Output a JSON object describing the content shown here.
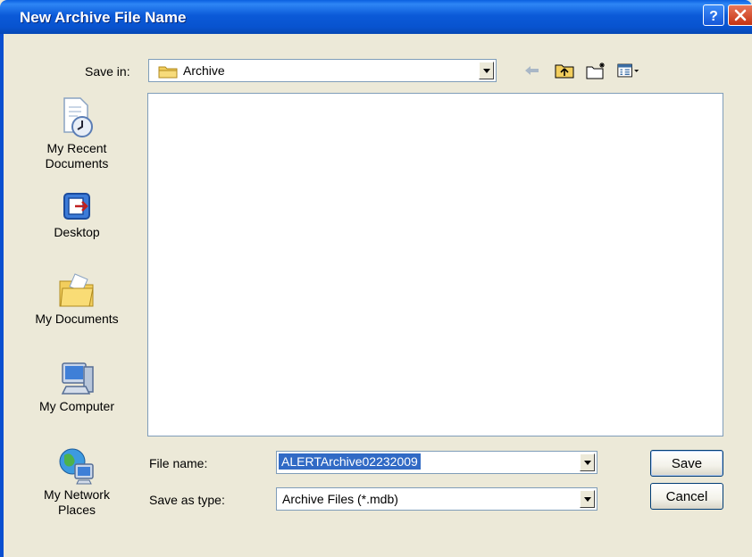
{
  "window": {
    "title": "New Archive File Name"
  },
  "save_in": {
    "label": "Save in:",
    "value": "Archive"
  },
  "toolbar": {
    "back_icon": "back-arrow-icon",
    "up_icon": "up-folder-icon",
    "new_folder_icon": "new-folder-icon",
    "views_icon": "views-menu-icon"
  },
  "places": [
    {
      "label_line1": "My Recent",
      "label_line2": "Documents",
      "icon": "recent-documents-icon"
    },
    {
      "label_line1": "Desktop",
      "label_line2": "",
      "icon": "desktop-icon"
    },
    {
      "label_line1": "My Documents",
      "label_line2": "",
      "icon": "my-documents-icon"
    },
    {
      "label_line1": "My Computer",
      "label_line2": "",
      "icon": "my-computer-icon"
    },
    {
      "label_line1": "My Network",
      "label_line2": "Places",
      "icon": "network-places-icon"
    }
  ],
  "file_name": {
    "label": "File name:",
    "value": "ALERTArchive02232009"
  },
  "save_as_type": {
    "label": "Save as type:",
    "value": "Archive Files (*.mdb)"
  },
  "buttons": {
    "save": "Save",
    "cancel": "Cancel"
  },
  "colors": {
    "title_bar": "#0853CF",
    "dialog_bg": "#ECE9D8",
    "selection": "#316AC5"
  }
}
